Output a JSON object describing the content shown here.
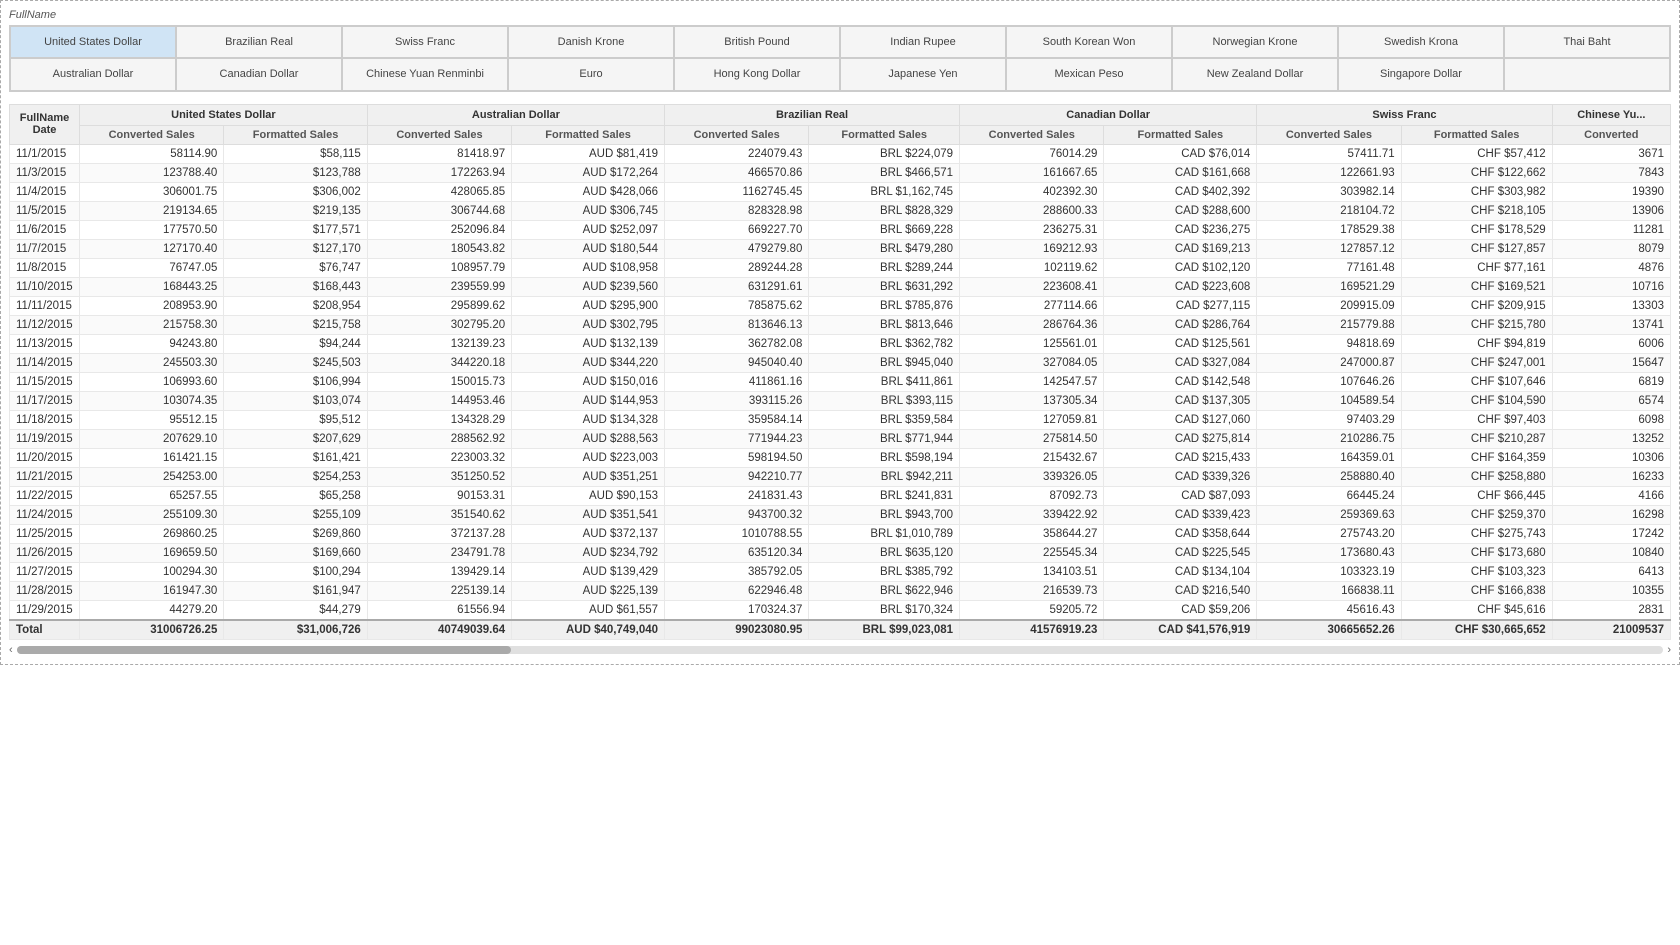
{
  "fullname_label": "FullName",
  "currency_rows": [
    [
      {
        "label": "United States Dollar",
        "selected": true
      },
      {
        "label": "Brazilian Real",
        "selected": false
      },
      {
        "label": "Swiss Franc",
        "selected": false
      },
      {
        "label": "Danish Krone",
        "selected": false
      },
      {
        "label": "British Pound",
        "selected": false
      },
      {
        "label": "Indian Rupee",
        "selected": false
      },
      {
        "label": "South Korean Won",
        "selected": false
      },
      {
        "label": "Norwegian Krone",
        "selected": false
      },
      {
        "label": "Swedish Krona",
        "selected": false
      },
      {
        "label": "Thai Baht",
        "selected": false
      }
    ],
    [
      {
        "label": "Australian Dollar",
        "selected": false
      },
      {
        "label": "Canadian Dollar",
        "selected": false
      },
      {
        "label": "Chinese Yuan Renminbi",
        "selected": false
      },
      {
        "label": "Euro",
        "selected": false
      },
      {
        "label": "Hong Kong Dollar",
        "selected": false
      },
      {
        "label": "Japanese Yen",
        "selected": false
      },
      {
        "label": "Mexican Peso",
        "selected": false
      },
      {
        "label": "New Zealand Dollar",
        "selected": false
      },
      {
        "label": "Singapore Dollar",
        "selected": false
      },
      {
        "label": "",
        "selected": false
      }
    ]
  ],
  "table_headers": {
    "col1": "FullName\nDate",
    "groups": [
      {
        "name": "United States Dollar",
        "sub1": "Converted Sales",
        "sub2": "Formatted Sales"
      },
      {
        "name": "Australian Dollar",
        "sub1": "Converted Sales",
        "sub2": "Formatted Sales"
      },
      {
        "name": "Brazilian Real",
        "sub1": "Converted Sales",
        "sub2": "Formatted Sales"
      },
      {
        "name": "Canadian Dollar",
        "sub1": "Converted Sales",
        "sub2": "Formatted Sales"
      },
      {
        "name": "Swiss Franc",
        "sub1": "Converted Sales",
        "sub2": "Formatted Sales"
      },
      {
        "name": "Chinese Yuan\nConverted",
        "sub1": "",
        "sub2": ""
      }
    ]
  },
  "rows": [
    {
      "date": "11/1/2015",
      "usd_conv": "58114.90",
      "usd_fmt": "$58,115",
      "aud_conv": "81418.97",
      "aud_fmt": "AUD $81,419",
      "brl_conv": "224079.43",
      "brl_fmt": "BRL $224,079",
      "cad_conv": "76014.29",
      "cad_fmt": "CAD $76,014",
      "chf_conv": "57411.71",
      "chf_fmt": "CHF $57,412",
      "cny_conv": "3671"
    },
    {
      "date": "11/3/2015",
      "usd_conv": "123788.40",
      "usd_fmt": "$123,788",
      "aud_conv": "172263.94",
      "aud_fmt": "AUD $172,264",
      "brl_conv": "466570.86",
      "brl_fmt": "BRL $466,571",
      "cad_conv": "161667.65",
      "cad_fmt": "CAD $161,668",
      "chf_conv": "122661.93",
      "chf_fmt": "CHF $122,662",
      "cny_conv": "7843"
    },
    {
      "date": "11/4/2015",
      "usd_conv": "306001.75",
      "usd_fmt": "$306,002",
      "aud_conv": "428065.85",
      "aud_fmt": "AUD $428,066",
      "brl_conv": "1162745.45",
      "brl_fmt": "BRL $1,162,745",
      "cad_conv": "402392.30",
      "cad_fmt": "CAD $402,392",
      "chf_conv": "303982.14",
      "chf_fmt": "CHF $303,982",
      "cny_conv": "19390"
    },
    {
      "date": "11/5/2015",
      "usd_conv": "219134.65",
      "usd_fmt": "$219,135",
      "aud_conv": "306744.68",
      "aud_fmt": "AUD $306,745",
      "brl_conv": "828328.98",
      "brl_fmt": "BRL $828,329",
      "cad_conv": "288600.33",
      "cad_fmt": "CAD $288,600",
      "chf_conv": "218104.72",
      "chf_fmt": "CHF $218,105",
      "cny_conv": "13906"
    },
    {
      "date": "11/6/2015",
      "usd_conv": "177570.50",
      "usd_fmt": "$177,571",
      "aud_conv": "252096.84",
      "aud_fmt": "AUD $252,097",
      "brl_conv": "669227.70",
      "brl_fmt": "BRL $669,228",
      "cad_conv": "236275.31",
      "cad_fmt": "CAD $236,275",
      "chf_conv": "178529.38",
      "chf_fmt": "CHF $178,529",
      "cny_conv": "11281"
    },
    {
      "date": "11/7/2015",
      "usd_conv": "127170.40",
      "usd_fmt": "$127,170",
      "aud_conv": "180543.82",
      "aud_fmt": "AUD $180,544",
      "brl_conv": "479279.80",
      "brl_fmt": "BRL $479,280",
      "cad_conv": "169212.93",
      "cad_fmt": "CAD $169,213",
      "chf_conv": "127857.12",
      "chf_fmt": "CHF $127,857",
      "cny_conv": "8079"
    },
    {
      "date": "11/8/2015",
      "usd_conv": "76747.05",
      "usd_fmt": "$76,747",
      "aud_conv": "108957.79",
      "aud_fmt": "AUD $108,958",
      "brl_conv": "289244.28",
      "brl_fmt": "BRL $289,244",
      "cad_conv": "102119.62",
      "cad_fmt": "CAD $102,120",
      "chf_conv": "77161.48",
      "chf_fmt": "CHF $77,161",
      "cny_conv": "4876"
    },
    {
      "date": "11/10/2015",
      "usd_conv": "168443.25",
      "usd_fmt": "$168,443",
      "aud_conv": "239559.99",
      "aud_fmt": "AUD $239,560",
      "brl_conv": "631291.61",
      "brl_fmt": "BRL $631,292",
      "cad_conv": "223608.41",
      "cad_fmt": "CAD $223,608",
      "chf_conv": "169521.29",
      "chf_fmt": "CHF $169,521",
      "cny_conv": "10716"
    },
    {
      "date": "11/11/2015",
      "usd_conv": "208953.90",
      "usd_fmt": "$208,954",
      "aud_conv": "295899.62",
      "aud_fmt": "AUD $295,900",
      "brl_conv": "785875.62",
      "brl_fmt": "BRL $785,876",
      "cad_conv": "277114.66",
      "cad_fmt": "CAD $277,115",
      "chf_conv": "209915.09",
      "chf_fmt": "CHF $209,915",
      "cny_conv": "13303"
    },
    {
      "date": "11/12/2015",
      "usd_conv": "215758.30",
      "usd_fmt": "$215,758",
      "aud_conv": "302795.20",
      "aud_fmt": "AUD $302,795",
      "brl_conv": "813646.13",
      "brl_fmt": "BRL $813,646",
      "cad_conv": "286764.36",
      "cad_fmt": "CAD $286,764",
      "chf_conv": "215779.88",
      "chf_fmt": "CHF $215,780",
      "cny_conv": "13741"
    },
    {
      "date": "11/13/2015",
      "usd_conv": "94243.80",
      "usd_fmt": "$94,244",
      "aud_conv": "132139.23",
      "aud_fmt": "AUD $132,139",
      "brl_conv": "362782.08",
      "brl_fmt": "BRL $362,782",
      "cad_conv": "125561.01",
      "cad_fmt": "CAD $125,561",
      "chf_conv": "94818.69",
      "chf_fmt": "CHF $94,819",
      "cny_conv": "6006"
    },
    {
      "date": "11/14/2015",
      "usd_conv": "245503.30",
      "usd_fmt": "$245,503",
      "aud_conv": "344220.18",
      "aud_fmt": "AUD $344,220",
      "brl_conv": "945040.40",
      "brl_fmt": "BRL $945,040",
      "cad_conv": "327084.05",
      "cad_fmt": "CAD $327,084",
      "chf_conv": "247000.87",
      "chf_fmt": "CHF $247,001",
      "cny_conv": "15647"
    },
    {
      "date": "11/15/2015",
      "usd_conv": "106993.60",
      "usd_fmt": "$106,994",
      "aud_conv": "150015.73",
      "aud_fmt": "AUD $150,016",
      "brl_conv": "411861.16",
      "brl_fmt": "BRL $411,861",
      "cad_conv": "142547.57",
      "cad_fmt": "CAD $142,548",
      "chf_conv": "107646.26",
      "chf_fmt": "CHF $107,646",
      "cny_conv": "6819"
    },
    {
      "date": "11/17/2015",
      "usd_conv": "103074.35",
      "usd_fmt": "$103,074",
      "aud_conv": "144953.46",
      "aud_fmt": "AUD $144,953",
      "brl_conv": "393115.26",
      "brl_fmt": "BRL $393,115",
      "cad_conv": "137305.34",
      "cad_fmt": "CAD $137,305",
      "chf_conv": "104589.54",
      "chf_fmt": "CHF $104,590",
      "cny_conv": "6574"
    },
    {
      "date": "11/18/2015",
      "usd_conv": "95512.15",
      "usd_fmt": "$95,512",
      "aud_conv": "134328.29",
      "aud_fmt": "AUD $134,328",
      "brl_conv": "359584.14",
      "brl_fmt": "BRL $359,584",
      "cad_conv": "127059.81",
      "cad_fmt": "CAD $127,060",
      "chf_conv": "97403.29",
      "chf_fmt": "CHF $97,403",
      "cny_conv": "6098"
    },
    {
      "date": "11/19/2015",
      "usd_conv": "207629.10",
      "usd_fmt": "$207,629",
      "aud_conv": "288562.92",
      "aud_fmt": "AUD $288,563",
      "brl_conv": "771944.23",
      "brl_fmt": "BRL $771,944",
      "cad_conv": "275814.50",
      "cad_fmt": "CAD $275,814",
      "chf_conv": "210286.75",
      "chf_fmt": "CHF $210,287",
      "cny_conv": "13252"
    },
    {
      "date": "11/20/2015",
      "usd_conv": "161421.15",
      "usd_fmt": "$161,421",
      "aud_conv": "223003.32",
      "aud_fmt": "AUD $223,003",
      "brl_conv": "598194.50",
      "brl_fmt": "BRL $598,194",
      "cad_conv": "215432.67",
      "cad_fmt": "CAD $215,433",
      "chf_conv": "164359.01",
      "chf_fmt": "CHF $164,359",
      "cny_conv": "10306"
    },
    {
      "date": "11/21/2015",
      "usd_conv": "254253.00",
      "usd_fmt": "$254,253",
      "aud_conv": "351250.52",
      "aud_fmt": "AUD $351,251",
      "brl_conv": "942210.77",
      "brl_fmt": "BRL $942,211",
      "cad_conv": "339326.05",
      "cad_fmt": "CAD $339,326",
      "chf_conv": "258880.40",
      "chf_fmt": "CHF $258,880",
      "cny_conv": "16233"
    },
    {
      "date": "11/22/2015",
      "usd_conv": "65257.55",
      "usd_fmt": "$65,258",
      "aud_conv": "90153.31",
      "aud_fmt": "AUD $90,153",
      "brl_conv": "241831.43",
      "brl_fmt": "BRL $241,831",
      "cad_conv": "87092.73",
      "cad_fmt": "CAD $87,093",
      "chf_conv": "66445.24",
      "chf_fmt": "CHF $66,445",
      "cny_conv": "4166"
    },
    {
      "date": "11/24/2015",
      "usd_conv": "255109.30",
      "usd_fmt": "$255,109",
      "aud_conv": "351540.62",
      "aud_fmt": "AUD $351,541",
      "brl_conv": "943700.32",
      "brl_fmt": "BRL $943,700",
      "cad_conv": "339422.92",
      "cad_fmt": "CAD $339,423",
      "chf_conv": "259369.63",
      "chf_fmt": "CHF $259,370",
      "cny_conv": "16298"
    },
    {
      "date": "11/25/2015",
      "usd_conv": "269860.25",
      "usd_fmt": "$269,860",
      "aud_conv": "372137.28",
      "aud_fmt": "AUD $372,137",
      "brl_conv": "1010788.55",
      "brl_fmt": "BRL $1,010,789",
      "cad_conv": "358644.27",
      "cad_fmt": "CAD $358,644",
      "chf_conv": "275743.20",
      "chf_fmt": "CHF $275,743",
      "cny_conv": "17242"
    },
    {
      "date": "11/26/2015",
      "usd_conv": "169659.50",
      "usd_fmt": "$169,660",
      "aud_conv": "234791.78",
      "aud_fmt": "AUD $234,792",
      "brl_conv": "635120.34",
      "brl_fmt": "BRL $635,120",
      "cad_conv": "225545.34",
      "cad_fmt": "CAD $225,545",
      "chf_conv": "173680.43",
      "chf_fmt": "CHF $173,680",
      "cny_conv": "10840"
    },
    {
      "date": "11/27/2015",
      "usd_conv": "100294.30",
      "usd_fmt": "$100,294",
      "aud_conv": "139429.14",
      "aud_fmt": "AUD $139,429",
      "brl_conv": "385792.05",
      "brl_fmt": "BRL $385,792",
      "cad_conv": "134103.51",
      "cad_fmt": "CAD $134,104",
      "chf_conv": "103323.19",
      "chf_fmt": "CHF $103,323",
      "cny_conv": "6413"
    },
    {
      "date": "11/28/2015",
      "usd_conv": "161947.30",
      "usd_fmt": "$161,947",
      "aud_conv": "225139.14",
      "aud_fmt": "AUD $225,139",
      "brl_conv": "622946.48",
      "brl_fmt": "BRL $622,946",
      "cad_conv": "216539.73",
      "cad_fmt": "CAD $216,540",
      "chf_conv": "166838.11",
      "chf_fmt": "CHF $166,838",
      "cny_conv": "10355"
    },
    {
      "date": "11/29/2015",
      "usd_conv": "44279.20",
      "usd_fmt": "$44,279",
      "aud_conv": "61556.94",
      "aud_fmt": "AUD $61,557",
      "brl_conv": "170324.37",
      "brl_fmt": "BRL $170,324",
      "cad_conv": "59205.72",
      "cad_fmt": "CAD $59,206",
      "chf_conv": "45616.43",
      "chf_fmt": "CHF $45,616",
      "cny_conv": "2831"
    }
  ],
  "totals": {
    "label": "Total",
    "usd_conv": "31006726.25",
    "usd_fmt": "$31,006,726",
    "aud_conv": "40749039.64",
    "aud_fmt": "AUD $40,749,040",
    "brl_conv": "99023080.95",
    "brl_fmt": "BRL $99,023,081",
    "cad_conv": "41576919.23",
    "cad_fmt": "CAD $41,576,919",
    "chf_conv": "30665652.26",
    "chf_fmt": "CHF $30,665,652",
    "cny_conv": "21009537"
  },
  "scroll_indicator": ">"
}
